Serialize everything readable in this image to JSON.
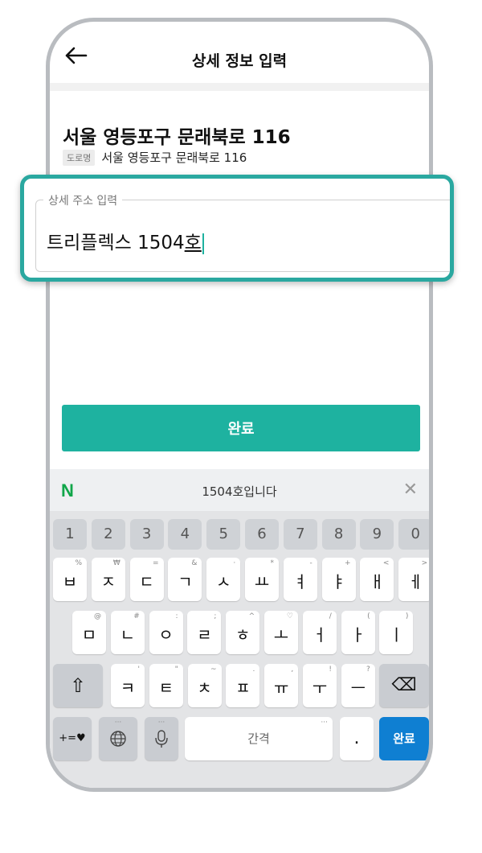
{
  "header": {
    "title": "상세 정보 입력"
  },
  "address": {
    "main": "서울 영등포구 문래북로 116",
    "road_tag": "도로명",
    "road_value": "서울 영등포구 문래북로 116"
  },
  "detail_field": {
    "label": "상세 주소 입력",
    "value_plain": "트리플렉스 1504",
    "value_composing": "호"
  },
  "confirm_button": {
    "label": "완료"
  },
  "keyboard": {
    "suggestion_logo": "N",
    "suggestion": "1504호입니다",
    "close_glyph": "✕",
    "numbers": [
      "1",
      "2",
      "3",
      "4",
      "5",
      "6",
      "7",
      "8",
      "9",
      "0"
    ],
    "row1": [
      {
        "k": "ㅂ",
        "h": "%"
      },
      {
        "k": "ㅈ",
        "h": "₩"
      },
      {
        "k": "ㄷ",
        "h": "="
      },
      {
        "k": "ㄱ",
        "h": "&"
      },
      {
        "k": "ㅅ",
        "h": "·"
      },
      {
        "k": "ㅛ",
        "h": "*"
      },
      {
        "k": "ㅕ",
        "h": "-"
      },
      {
        "k": "ㅑ",
        "h": "+"
      },
      {
        "k": "ㅐ",
        "h": "<"
      },
      {
        "k": "ㅔ",
        "h": ">"
      }
    ],
    "row2": [
      {
        "k": "ㅁ",
        "h": "@"
      },
      {
        "k": "ㄴ",
        "h": "#"
      },
      {
        "k": "ㅇ",
        "h": ":"
      },
      {
        "k": "ㄹ",
        "h": ";"
      },
      {
        "k": "ㅎ",
        "h": "^"
      },
      {
        "k": "ㅗ",
        "h": "♡"
      },
      {
        "k": "ㅓ",
        "h": "/"
      },
      {
        "k": "ㅏ",
        "h": "("
      },
      {
        "k": "ㅣ",
        "h": ")"
      }
    ],
    "row3": [
      {
        "k": "ㅋ",
        "h": "'"
      },
      {
        "k": "ㅌ",
        "h": "\""
      },
      {
        "k": "ㅊ",
        "h": "~"
      },
      {
        "k": "ㅍ",
        "h": "."
      },
      {
        "k": "ㅠ",
        "h": ","
      },
      {
        "k": "ㅜ",
        "h": "!"
      },
      {
        "k": "ㅡ",
        "h": "?"
      }
    ],
    "symbols_label": "+=♥",
    "space_label": "간격",
    "period_label": ".",
    "done_label": "완료",
    "shift_glyph": "⇧",
    "backspace_glyph": "⌫",
    "more_dots": "···"
  },
  "colors": {
    "accent": "#1eb2a0",
    "done_key": "#0f7fd2",
    "naver_green": "#10a64a"
  }
}
